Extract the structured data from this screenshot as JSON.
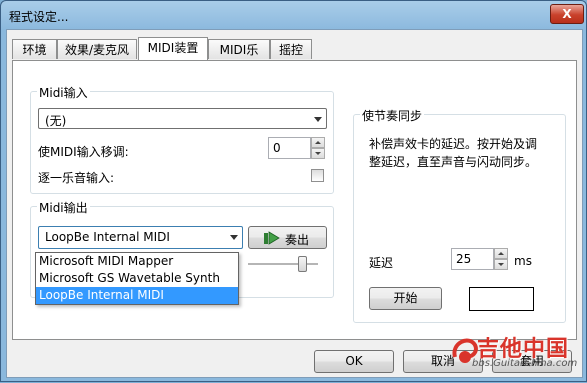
{
  "window": {
    "title": "程式设定...",
    "close_glyph": "X"
  },
  "tabs": [
    {
      "label": "环境",
      "active": false
    },
    {
      "label": "效果/麦克风",
      "active": false
    },
    {
      "label": "MIDI装置",
      "active": true
    },
    {
      "label": "MIDI乐器",
      "active": false
    },
    {
      "label": "摇控",
      "active": false
    }
  ],
  "midi_input": {
    "group_label": "Midi输入",
    "device_value": "(无)",
    "transpose_label": "使MIDI输入移调:",
    "transpose_value": "0",
    "step_label": "逐一乐音输入:",
    "step_checked": false
  },
  "midi_output": {
    "group_label": "Midi输出",
    "device_value": "LoopBe Internal MIDI",
    "play_label": "奏出",
    "options": [
      "Microsoft MIDI Mapper",
      "Microsoft GS Wavetable Synth",
      "LoopBe Internal MIDI"
    ],
    "selected_index": 2
  },
  "sync": {
    "group_label": "使节奏同步",
    "description_line1": "补偿声效卡的延迟。按开始及调",
    "description_line2": "整延迟，直至声音与闪动同步。",
    "delay_label": "延迟",
    "delay_value": "25",
    "delay_unit": "ms",
    "start_label": "开始"
  },
  "footer": {
    "ok_label": "OK",
    "cancel_label": "取消",
    "apply_label": "套用"
  },
  "watermark": {
    "brand": "吉他中国",
    "url": "bbs.GuitarChina.com"
  }
}
